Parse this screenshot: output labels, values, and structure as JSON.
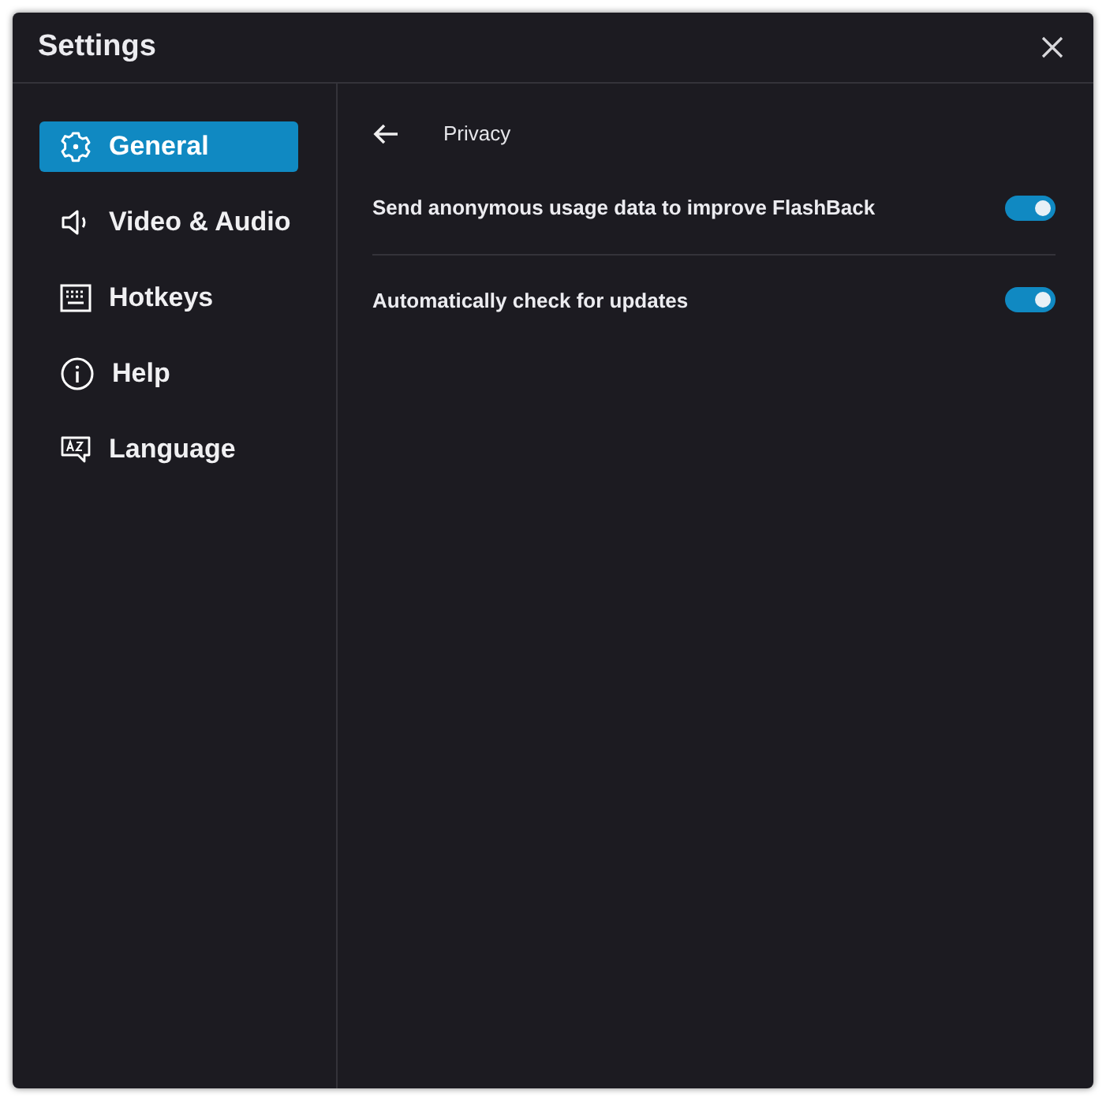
{
  "window": {
    "title": "Settings"
  },
  "sidebar": {
    "items": [
      {
        "label": "General",
        "kind": "general",
        "selected": true
      },
      {
        "label": "Video & Audio",
        "kind": "audio",
        "selected": false
      },
      {
        "label": "Hotkeys",
        "kind": "hotkeys",
        "selected": false
      },
      {
        "label": "Help",
        "kind": "help",
        "selected": false
      },
      {
        "label": "Language",
        "kind": "language",
        "selected": false
      }
    ]
  },
  "panel": {
    "title": "Privacy",
    "settings": [
      {
        "label": "Send anonymous usage data to improve FlashBack",
        "on": true
      },
      {
        "label": "Automatically check for updates",
        "on": true
      }
    ]
  }
}
